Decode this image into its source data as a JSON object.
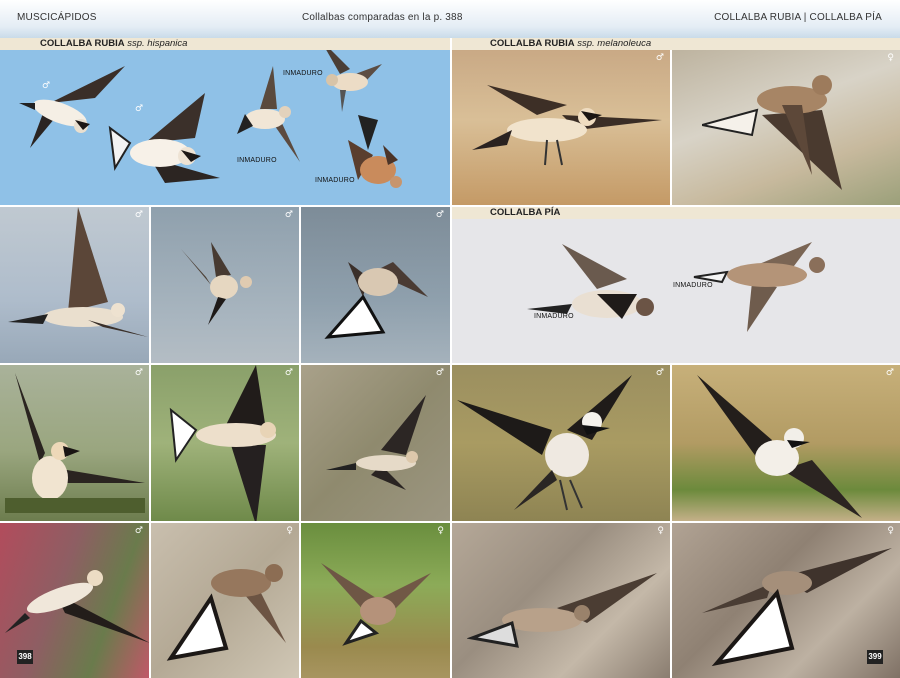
{
  "header": {
    "left": "MUSCICÁPIDOS",
    "center": "Collalbas comparadas en la p. 388",
    "right": "COLLALBA RUBIA | COLLALBA PÍA"
  },
  "sections": {
    "hispanica_name": "COLLALBA RUBIA",
    "hispanica_ssp": "ssp. hispanica",
    "melanoleuca_name": "COLLALBA RUBIA",
    "melanoleuca_ssp": "ssp. melanoleuca",
    "pia_name": "COLLALBA PÍA"
  },
  "labels": {
    "inmaduro": "INMADURO"
  },
  "symbols": {
    "male": "♂",
    "female": "♀"
  },
  "page_numbers": {
    "left": "398",
    "right": "399"
  }
}
